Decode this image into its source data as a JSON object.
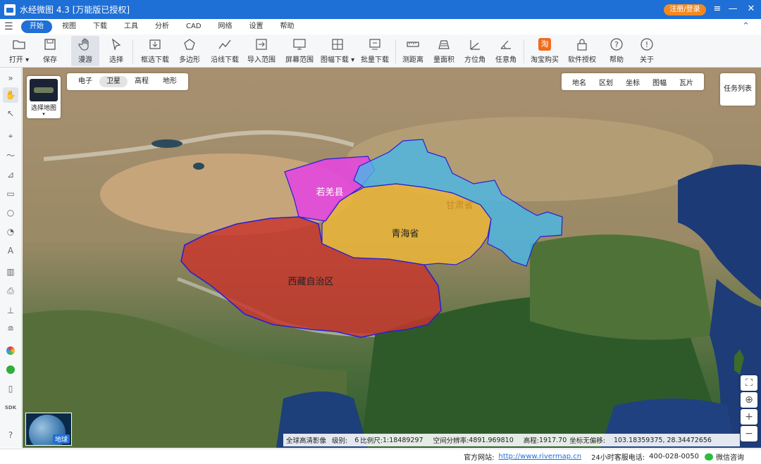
{
  "app": {
    "title": "水经微图 4.3 [万能版已授权]",
    "login_label": "注册/登录",
    "window_controls": [
      "≡",
      "—",
      "□",
      "✕"
    ]
  },
  "menu": {
    "items": [
      "开始",
      "视图",
      "下载",
      "工具",
      "分析",
      "CAD",
      "网络",
      "设置",
      "帮助"
    ],
    "active": "开始"
  },
  "toolbar": {
    "items": [
      {
        "label": "打开 ▾",
        "icon": "folder-icon"
      },
      {
        "label": "保存",
        "icon": "save-icon"
      },
      {
        "label": "漫游",
        "icon": "hand-icon",
        "selected": true
      },
      {
        "label": "选择",
        "icon": "cursor-icon"
      },
      {
        "label": "框选下载",
        "icon": "box-download-icon"
      },
      {
        "label": "多边形",
        "icon": "polygon-download-icon"
      },
      {
        "label": "沿线下载",
        "icon": "line-download-icon"
      },
      {
        "label": "导入范围",
        "icon": "import-range-icon"
      },
      {
        "label": "屏幕范围",
        "icon": "screen-range-icon"
      },
      {
        "label": "图幅下载 ▾",
        "icon": "sheet-download-icon"
      },
      {
        "label": "批量下载",
        "icon": "batch-download-icon"
      },
      {
        "label": "测距离",
        "icon": "ruler-icon"
      },
      {
        "label": "量面积",
        "icon": "area-icon"
      },
      {
        "label": "方位角",
        "icon": "azimuth-icon"
      },
      {
        "label": "任意角",
        "icon": "angle-icon"
      },
      {
        "label": "淘宝购买",
        "icon": "taobao-icon"
      },
      {
        "label": "软件授权",
        "icon": "lock-icon"
      },
      {
        "label": "帮助",
        "icon": "help-icon"
      },
      {
        "label": "关于",
        "icon": "info-icon"
      }
    ]
  },
  "left_tools": [
    "expand-icon",
    "hand-icon",
    "cursor-icon",
    "pin-icon",
    "polyline-icon",
    "area-chart-icon",
    "rectangle-icon",
    "circle-icon",
    "sector-icon",
    "text-icon",
    "ruler-icon",
    "printer-icon",
    "sheet-icon",
    "layer-icon",
    "color-icon",
    "link-icon",
    "phone-icon",
    "sdk-icon",
    "help-icon"
  ],
  "map": {
    "basemap_label": "选择地图",
    "map_types": [
      "电子",
      "卫星",
      "高程",
      "地形"
    ],
    "active_map_type": "卫星",
    "overlays": [
      "地名",
      "区划",
      "坐标",
      "图幅",
      "瓦片"
    ],
    "task_list_label": "任务列表",
    "globe_label": "地球",
    "regions": [
      {
        "name": "若羌县",
        "color": "#e545e0"
      },
      {
        "name": "甘肃省",
        "color": "#48b8e8"
      },
      {
        "name": "青海省",
        "color": "#e8b43a"
      },
      {
        "name": "西藏自治区",
        "color": "#c8352c"
      }
    ],
    "boundary_color": "#2a1fd6"
  },
  "status": {
    "imagery": "全球高清影像",
    "level_label": "级别:",
    "level": "6",
    "scale_label": "比例尺:",
    "scale": "1:18489297",
    "resolution_label": "空间分辨率:",
    "resolution": "4891.969810",
    "elevation_label": "高程:",
    "elevation": "1917.70",
    "coord_label": "坐标无偏移:",
    "coords": "103.18359375, 28.34472656"
  },
  "footer": {
    "website_label": "官方网站:",
    "website": "http://www.rivermap.cn",
    "phone_label": "24小时客服电话:",
    "phone": "400-028-0050",
    "wechat_label": "微信咨询"
  }
}
